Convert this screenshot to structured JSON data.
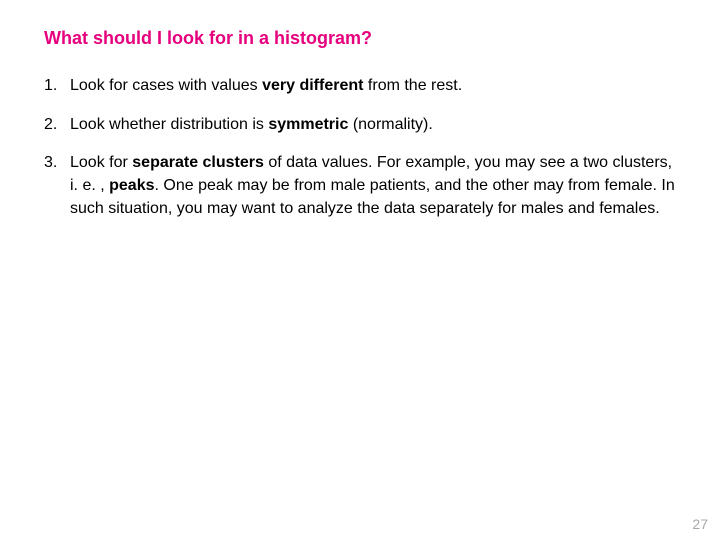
{
  "title": "What should I look for in a histogram?",
  "items": {
    "n1": "1.",
    "t1a": "Look for cases with values ",
    "t1b": "very different",
    "t1c": " from the rest.",
    "n2": "2.",
    "t2a": "Look whether distribution is ",
    "t2b": "symmetric",
    "t2c": " (normality).",
    "n3": "3.",
    "t3a": "Look for ",
    "t3b": "separate clusters",
    "t3c": " of data values.  For example, you may see a two clusters, i. e. , ",
    "t3d": "peaks",
    "t3e": ".  One peak may be from male patients, and the other may from female.  In such situation, you may want to analyze the data separately for males and females."
  },
  "page_number": "27"
}
